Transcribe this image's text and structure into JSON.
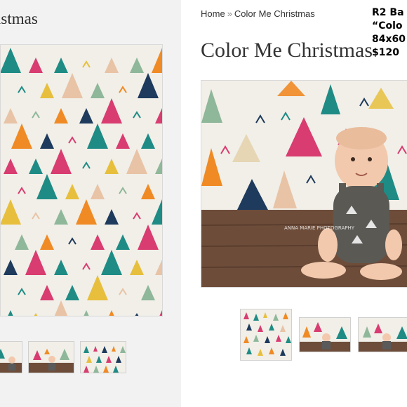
{
  "left": {
    "title": "istmas"
  },
  "breadcrumb": {
    "home": "Home",
    "separator": "»",
    "current": "Color Me Christmas"
  },
  "product": {
    "title": "Color Me Christmas",
    "info_lines": [
      "R2 Ba",
      "“Colo",
      "84x60",
      "$120"
    ]
  },
  "main_image": {
    "watermark": "ANNA MARIE PHOTOGRAPHY"
  },
  "palette": {
    "teal": "#1f8b85",
    "navy": "#1e3a5c",
    "pink": "#d83c71",
    "orange": "#f08a24",
    "yellow": "#e7bf3d",
    "sage": "#8fb79a",
    "peach": "#e9c3a6",
    "cream": "#f1efe8",
    "floor": "#6d4d3a"
  }
}
